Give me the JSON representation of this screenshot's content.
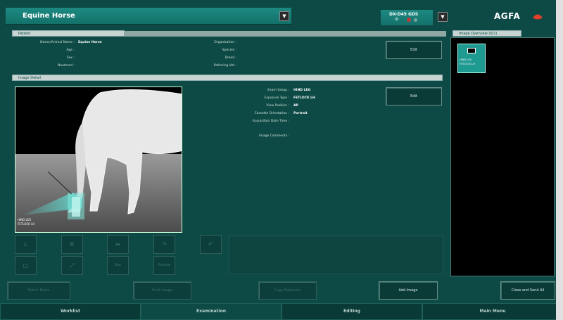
{
  "header": {
    "patient_title": "Equine Horse",
    "device_line1": "DX-D45 GDS",
    "device_line2": "ID",
    "brand": "AGFA"
  },
  "colors": {
    "accent": "#13716a",
    "background": "#0e4a45",
    "brand_logo": "#e0402a"
  },
  "patient": {
    "section_label": "Patient",
    "left_labels": [
      "Owner/Animal Name :",
      "Age :",
      "Sex :",
      "Neutered :"
    ],
    "name_value": "Equine Horse",
    "right_labels": [
      "Organization :",
      "Species :",
      "Breed :",
      "Referring Vet :"
    ],
    "edit_label": "Edit"
  },
  "image_detail": {
    "section_label": "Image Detail",
    "labels": [
      "Exam Group :",
      "Exposure Type :",
      "View Position :",
      "Cassette Orientation :",
      "Acquisition Date Time :",
      "Image Comments :"
    ],
    "values": [
      "HIND LEG",
      "FETLOCK LH",
      "AP",
      "Portrait",
      "",
      ""
    ],
    "edit_label": "Edit",
    "image_caption_line1": "HIND LEG",
    "image_caption_line2": "FETLOCK LH"
  },
  "overview": {
    "section_label": "Image Overview (0/1)",
    "thumb_line1": "HIND LEG",
    "thumb_line2": "FETLOCK LH"
  },
  "tools": {
    "row1": [
      "L",
      "R",
      "↔",
      "↷",
      "↶"
    ],
    "row2": [
      "□",
      "⤢",
      "Text",
      "Preview"
    ]
  },
  "actions": {
    "select_exam": "Select Exam",
    "print_image": "Print Image",
    "copy_exposure": "Copy Exposure",
    "add_image": "Add Image",
    "close_send": "Close and Send All"
  },
  "tabs": [
    "Worklist",
    "Examination",
    "Editing",
    "Main Menu"
  ],
  "active_tab": "Examination"
}
